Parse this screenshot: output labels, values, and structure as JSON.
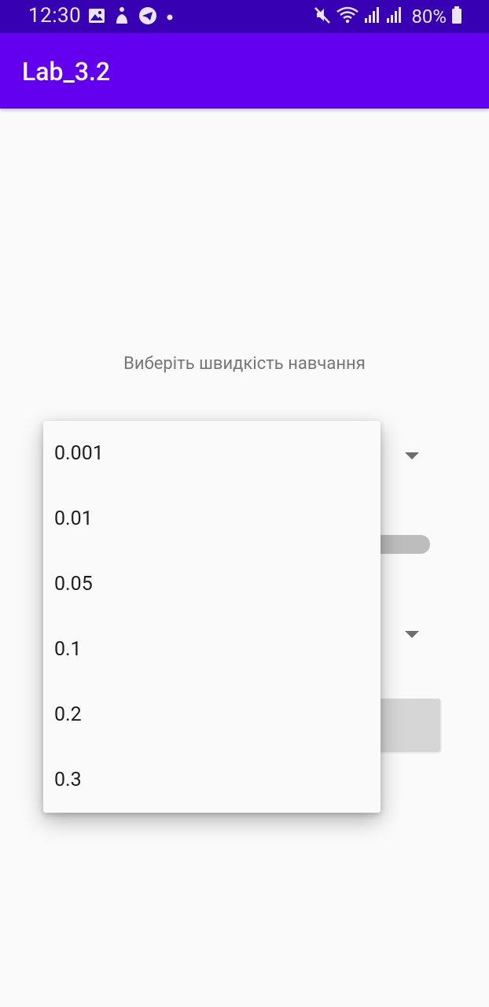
{
  "status_bar": {
    "time": "12:30",
    "battery_percent": "80%",
    "left_icons": [
      "gallery-icon",
      "accessibility-icon",
      "telegram-icon",
      "dot-icon"
    ],
    "right_icons": [
      "mute-icon",
      "wifi-icon",
      "signal-icon",
      "signal-icon",
      "battery-icon"
    ]
  },
  "app_bar": {
    "title": "Lab_3.2"
  },
  "content": {
    "prompt": "Виберіть швидкість навчання"
  },
  "dropdown": {
    "options": [
      "0.001",
      "0.01",
      "0.05",
      "0.1",
      "0.2",
      "0.3"
    ]
  },
  "colors": {
    "status_bar": "#3700b3",
    "app_bar": "#6200ee",
    "background": "#fafafa"
  }
}
